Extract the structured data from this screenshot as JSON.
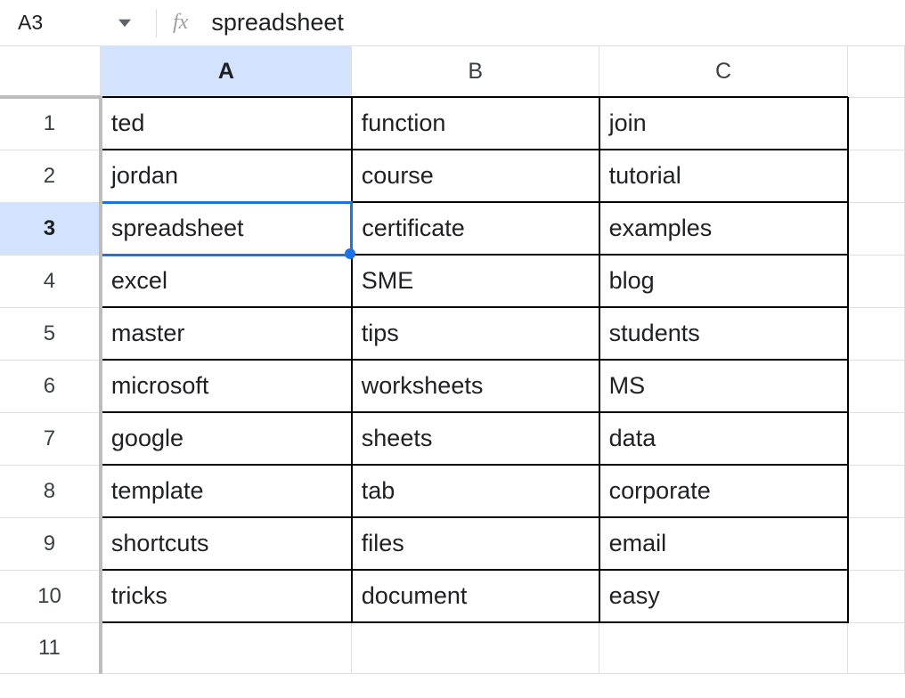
{
  "namebox": {
    "value": "A3"
  },
  "formula": {
    "value": "spreadsheet",
    "fx_label": "fx"
  },
  "columns": [
    "A",
    "B",
    "C"
  ],
  "rows": [
    "1",
    "2",
    "3",
    "4",
    "5",
    "6",
    "7",
    "8",
    "9",
    "10",
    "11"
  ],
  "selected": {
    "col": "A",
    "row": "3"
  },
  "cells": {
    "r1": {
      "A": "ted",
      "B": "function",
      "C": "join"
    },
    "r2": {
      "A": "jordan",
      "B": "course",
      "C": "tutorial"
    },
    "r3": {
      "A": "spreadsheet",
      "B": "certificate",
      "C": "examples"
    },
    "r4": {
      "A": "excel",
      "B": "SME",
      "C": "blog"
    },
    "r5": {
      "A": "master",
      "B": "tips",
      "C": "students"
    },
    "r6": {
      "A": "microsoft",
      "B": "worksheets",
      "C": "MS"
    },
    "r7": {
      "A": "google",
      "B": "sheets",
      "C": "data"
    },
    "r8": {
      "A": "template",
      "B": "tab",
      "C": "corporate"
    },
    "r9": {
      "A": "shortcuts",
      "B": "files",
      "C": "email"
    },
    "r10": {
      "A": "tricks",
      "B": "document",
      "C": "easy"
    }
  }
}
